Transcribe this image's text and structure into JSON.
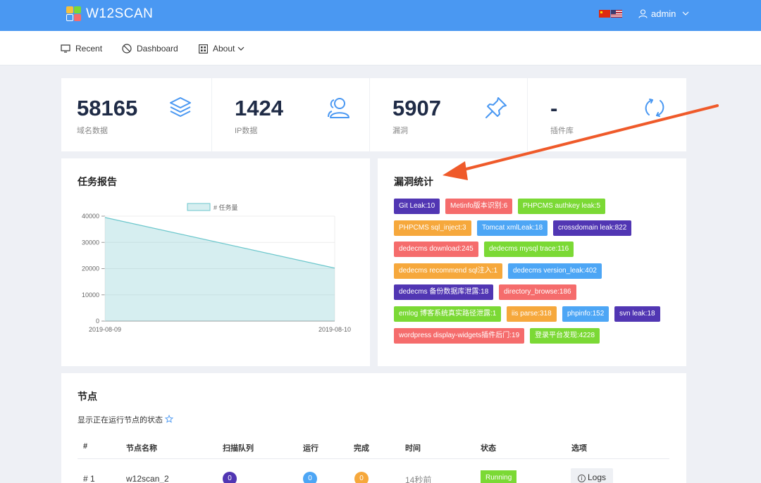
{
  "app": {
    "brand": "W12SCAN"
  },
  "header": {
    "user": "admin"
  },
  "nav": {
    "recent": "Recent",
    "dashboard": "Dashboard",
    "about": "About"
  },
  "stats": [
    {
      "value": "58165",
      "label": "域名数据",
      "icon": "layers-icon"
    },
    {
      "value": "1424",
      "label": "IP数据",
      "icon": "users-icon"
    },
    {
      "value": "5907",
      "label": "漏洞",
      "icon": "pin-icon"
    },
    {
      "value": "-",
      "label": "插件库",
      "icon": "refresh-icon"
    }
  ],
  "report": {
    "title": "任务报告",
    "chart_data": {
      "type": "area",
      "x": [
        "2019-08-09",
        "2019-08-10"
      ],
      "series": [
        {
          "name": "# 任务量",
          "values": [
            39500,
            20200
          ]
        }
      ],
      "ylim": [
        0,
        40000
      ],
      "yticks": [
        "40000",
        "30000",
        "20000",
        "10000",
        "0"
      ],
      "grid": true,
      "legend": "top-center"
    }
  },
  "vuln": {
    "title": "漏洞统计",
    "tags": [
      {
        "label": "Git Leak:10",
        "color": "#5136b3"
      },
      {
        "label": "Metinfo版本识别:6",
        "color": "#f56c6c"
      },
      {
        "label": "PHPCMS authkey leak:5",
        "color": "#7bd935"
      },
      {
        "label": "PHPCMS sql_inject:3",
        "color": "#f6a83c"
      },
      {
        "label": "Tomcat xmlLeak:18",
        "color": "#4da6f5"
      },
      {
        "label": "crossdomain leak:822",
        "color": "#5136b3"
      },
      {
        "label": "dedecms download:245",
        "color": "#f56c6c"
      },
      {
        "label": "dedecms mysql trace:116",
        "color": "#7bd935"
      },
      {
        "label": "dedecms recommend sql注入:1",
        "color": "#f6a83c"
      },
      {
        "label": "dedecms version_leak:402",
        "color": "#4da6f5"
      },
      {
        "label": "dedecms 备份数据库泄露:18",
        "color": "#5136b3"
      },
      {
        "label": "directory_browse:186",
        "color": "#f56c6c"
      },
      {
        "label": "emlog 博客系统真实路径泄露:1",
        "color": "#7bd935"
      },
      {
        "label": "iis parse:318",
        "color": "#f6a83c"
      },
      {
        "label": "phpinfo:152",
        "color": "#4da6f5"
      },
      {
        "label": "svn leak:18",
        "color": "#5136b3"
      },
      {
        "label": "wordpress display-widgets插件后门:19",
        "color": "#f56c6c"
      },
      {
        "label": "登录平台发现:4228",
        "color": "#7bd935"
      }
    ]
  },
  "nodes": {
    "title": "节点",
    "subtitle": "显示正在运行节点的状态",
    "columns": [
      "#",
      "节点名称",
      "扫描队列",
      "运行",
      "完成",
      "时间",
      "状态",
      "选项"
    ],
    "rows": [
      {
        "index": "# 1",
        "name": "w12scan_2",
        "queue": "0",
        "running": "0",
        "done": "0",
        "time": "14秒前",
        "status": "Running",
        "action": "Logs"
      }
    ]
  },
  "colors": {
    "header": "#4a98f2",
    "accent": "#4a98f2",
    "arrow": "#ef5a2a"
  }
}
